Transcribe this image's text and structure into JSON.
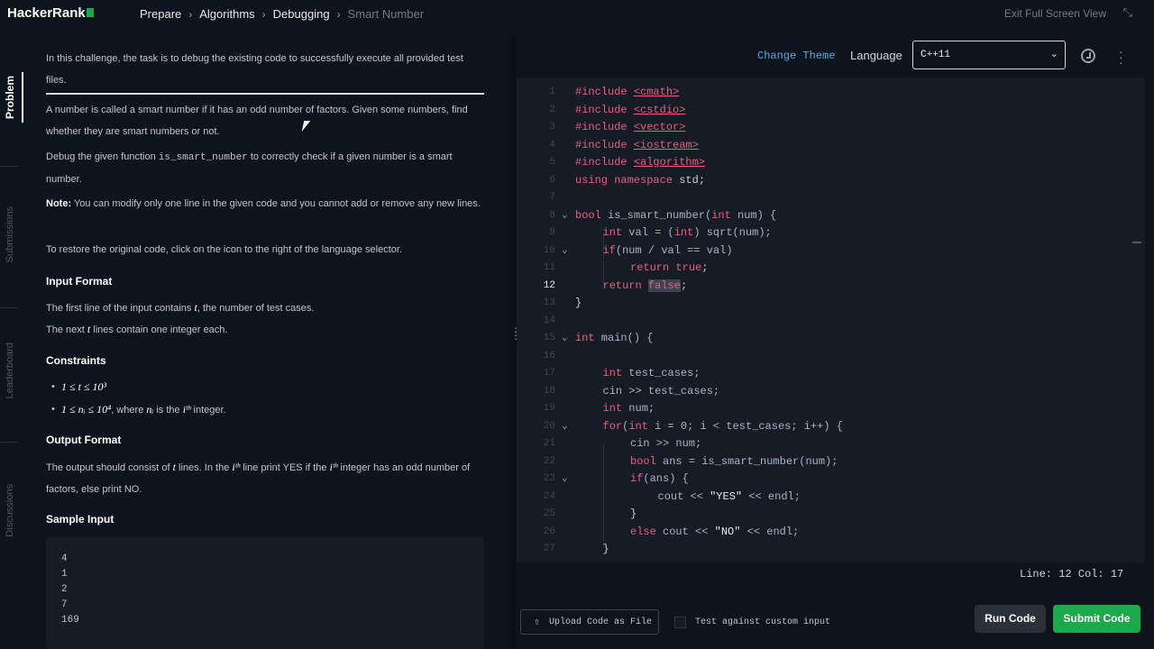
{
  "header": {
    "logo": "HackerRank",
    "breadcrumbs": [
      "Prepare",
      "Algorithms",
      "Debugging",
      "Smart Number"
    ],
    "exit_full_screen": "Exit Full Screen View"
  },
  "nav_tabs": [
    "Problem",
    "Submissions",
    "Leaderboard",
    "Discussions"
  ],
  "problem": {
    "intro": "In this challenge, the task is to debug the existing code to successfully execute all provided test files.",
    "p1": "A number is called a smart number if it has an odd number of factors. Given some numbers, find whether they are smart numbers or not.",
    "p2_a": "Debug the given function ",
    "p2_code": "is_smart_number",
    "p2_b": " to correctly check if a given number is a smart number.",
    "note_label": "Note:",
    "note_text": " You can modify only one line in the given code and you cannot add or remove any new lines.",
    "restore": "To restore the original code, click on the icon to the right of the language selector.",
    "input_format_title": "Input Format",
    "input_line1_a": "The first line of the input contains ",
    "input_line1_var": "t",
    "input_line1_b": ", the number of test cases.",
    "input_line2_a": "The next ",
    "input_line2_var": "t",
    "input_line2_b": " lines contain one integer each.",
    "constraints_title": "Constraints",
    "constraint1": "1 ≤ t ≤ 10³",
    "constraint2_a": "1 ≤ nᵢ ≤ 10⁴",
    "constraint2_b": ", where ",
    "constraint2_var": "nᵢ",
    "constraint2_c": " is the ",
    "constraint2_ith": "iᵗʰ",
    "constraint2_d": " integer.",
    "output_format_title": "Output Format",
    "output_a": "The output should consist of ",
    "output_var_t": "t",
    "output_b": " lines. In the ",
    "output_ith1": "iᵗʰ",
    "output_c": " line print YES if the ",
    "output_ith2": "iᵗʰ",
    "output_d": " integer has an odd number of factors, else print NO.",
    "sample_input_title": "Sample Input",
    "sample_input": [
      "4",
      "1",
      "2",
      "7",
      "169"
    ]
  },
  "editor_header": {
    "change_theme": "Change Theme",
    "language_label": "Language",
    "language_value": "C++11"
  },
  "code": {
    "current_line": 12,
    "lines": [
      {
        "n": "1"
      },
      {
        "n": "2"
      },
      {
        "n": "3"
      },
      {
        "n": "4"
      },
      {
        "n": "5"
      },
      {
        "n": "6"
      },
      {
        "n": "7"
      },
      {
        "n": "8"
      },
      {
        "n": "9"
      },
      {
        "n": "10"
      },
      {
        "n": "11"
      },
      {
        "n": "12"
      },
      {
        "n": "13"
      },
      {
        "n": "14"
      },
      {
        "n": "15"
      },
      {
        "n": "16"
      },
      {
        "n": "17"
      },
      {
        "n": "18"
      },
      {
        "n": "19"
      },
      {
        "n": "20"
      },
      {
        "n": "21"
      },
      {
        "n": "22"
      },
      {
        "n": "23"
      },
      {
        "n": "24"
      },
      {
        "n": "25"
      },
      {
        "n": "26"
      },
      {
        "n": "27"
      }
    ],
    "text": {
      "l1_kw": "#include",
      "l1_hdr": "<cmath>",
      "l2_kw": "#include",
      "l2_hdr": "<cstdio>",
      "l3_kw": "#include",
      "l3_hdr": "<vector>",
      "l4_kw": "#include",
      "l4_hdr": "<iostream>",
      "l5_kw": "#include",
      "l5_hdr": "<algorithm>",
      "l6_kw": "using namespace",
      "l6_rest": " std;",
      "l8_kw": "bool",
      "l8_rest": " is_smart_number(",
      "l8_ty": "int",
      "l8_rest2": " num) {",
      "l9_ty": "int",
      "l9_rest": " val = (",
      "l9_ty2": "int",
      "l9_rest2": ") sqrt(num);",
      "l10_kw": "if",
      "l10_rest": "(num / val == val)",
      "l11_kw": "return",
      "l11_rest": " ",
      "l11_kw2": "true",
      "l11_end": ";",
      "l12_kw": "return",
      "l12_sp": " ",
      "l12_sel": "false",
      "l12_end": ";",
      "l13": "}",
      "l15_ty": "int",
      "l15_rest": " main() {",
      "l17_ty": "int",
      "l17_rest": " test_cases;",
      "l18": "cin >> test_cases;",
      "l19_ty": "int",
      "l19_rest": " num;",
      "l20_kw": "for",
      "l20_a": "(",
      "l20_ty": "int",
      "l20_rest": " i = 0; i < test_cases; i++) {",
      "l21": "cin >> num;",
      "l22_kw": "bool",
      "l22_rest": " ans = is_smart_number(num);",
      "l23_kw": "if",
      "l23_rest": "(ans) {",
      "l24_a": "cout << ",
      "l24_str": "\"YES\"",
      "l24_b": " << endl;",
      "l25": "}",
      "l26_kw": "else",
      "l26_a": " cout << ",
      "l26_str": "\"NO\"",
      "l26_b": " << endl;",
      "l27": "}"
    }
  },
  "status": {
    "line_col": "Line: 12 Col: 17"
  },
  "bottom": {
    "upload": "Upload Code as File",
    "custom_input": "Test against custom input",
    "run": "Run Code",
    "submit": "Submit Code"
  },
  "colors": {
    "accent_green": "#1ba94c",
    "keyword_pink": "#ef5b7f",
    "link_blue": "#5aa9e6"
  }
}
